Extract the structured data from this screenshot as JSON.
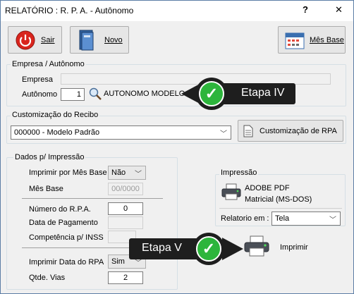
{
  "window": {
    "title": "RELATÓRIO : R. P. A. - Autônomo",
    "help_glyph": "?",
    "close_glyph": "✕"
  },
  "toolbar": {
    "sair_label": "Sair",
    "novo_label": "Novo",
    "mes_base_label": "Mês Base"
  },
  "empresa_group": {
    "title": "Empresa / Autônomo",
    "empresa_label": "Empresa",
    "empresa_value": "",
    "autonomo_label": "Autônomo",
    "autonomo_value": "1",
    "autonomo_name": "AUTONOMO MODELO"
  },
  "callouts": {
    "etapa4": "Etapa IV",
    "etapa5": "Etapa V"
  },
  "recibo_group": {
    "title": "Customização do Recibo",
    "modelo_value": "000000 - Modelo Padrão",
    "customizacao_button": "Customização de RPA"
  },
  "dados_group": {
    "title": "Dados p/ Impressão",
    "imprimir_mes_base_label": "Imprimir por Mês Base",
    "imprimir_mes_base_value": "Não",
    "mes_base_label": "Mês Base",
    "mes_base_value": "00/0000",
    "numero_rpa_label": "Número do R.P.A.",
    "numero_rpa_value": "0",
    "data_pagamento_label": "Data de Pagamento",
    "competencia_label": "Competência p/ INSS",
    "imprimir_data_label": "Imprimir Data do RPA",
    "imprimir_data_value": "Sim",
    "qtde_vias_label": "Qtde. Vias",
    "qtde_vias_value": "2"
  },
  "impressao_group": {
    "title": "Impressão",
    "printer_name": "ADOBE PDF",
    "printer_type": "Matricial (MS-DOS)",
    "relatorio_em_label": "Relatorio em :",
    "relatorio_em_value": "Tela",
    "imprimir_label": "Imprimir"
  },
  "colors": {
    "accent": "#2db53c",
    "callout_bg": "#1e1e1e",
    "sair_red": "#d9251d"
  },
  "icons": [
    "power-icon",
    "book-icon",
    "calendar-icon",
    "search-icon",
    "document-icon",
    "printer-icon",
    "check-icon",
    "chevron-down-icon"
  ]
}
